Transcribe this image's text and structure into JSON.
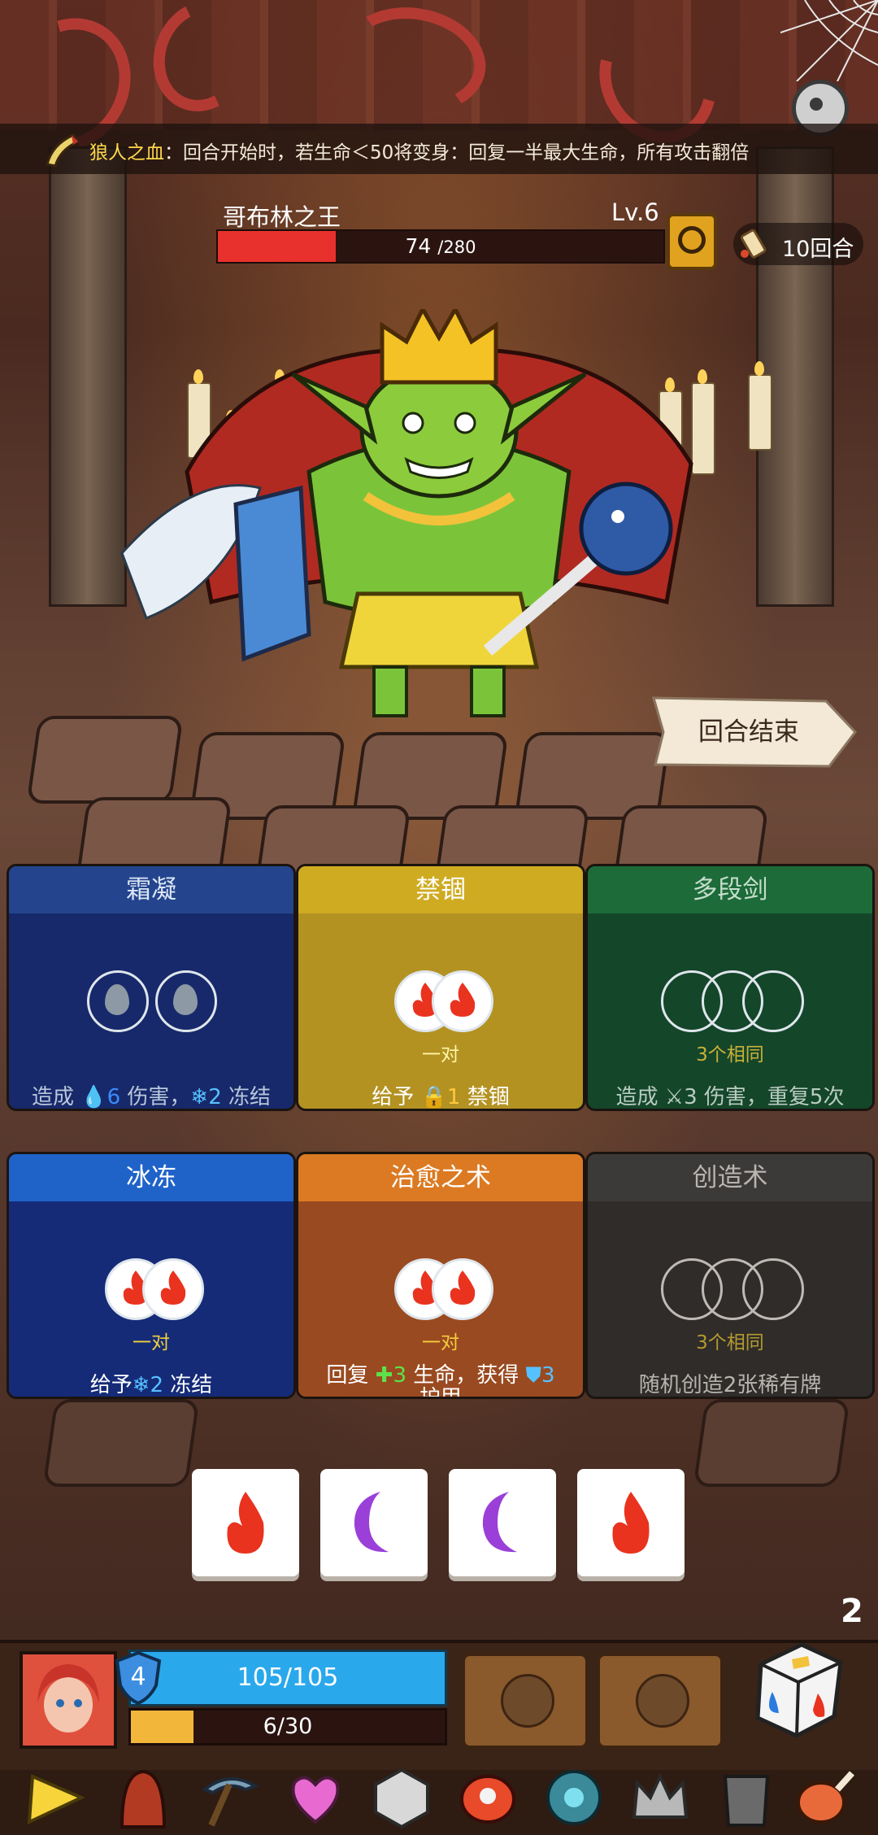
{
  "status": {
    "buff_name": "狼人之血",
    "buff_desc": "：回合开始时，若生命＜50将变身：回复一半最大生命，所有攻击翻倍"
  },
  "boss": {
    "name": "哥布林之王",
    "level": "Lv.6",
    "hp_current": "74",
    "hp_max": "/280",
    "hp_fraction": 0.264
  },
  "round": {
    "label": "10回合"
  },
  "end_turn": {
    "label": "回合结束"
  },
  "cards": [
    {
      "title": "霜凝",
      "requirement": "",
      "desc_prefix": "造成 ",
      "num1": "6",
      "desc_mid": " 伤害，",
      "num2": "2",
      "desc_suffix": " 冻结",
      "color": "#17296a",
      "head": "#24458d"
    },
    {
      "title": "禁锢",
      "requirement": "一对",
      "desc_prefix": "给予 ",
      "num1": "1",
      "desc_suffix": " 禁锢",
      "color": "#b39222",
      "head": "#cfab22"
    },
    {
      "title": "多段剑",
      "requirement": "3个相同",
      "desc_prefix": "造成 ",
      "num1": "3",
      "desc_suffix": " 伤害，重复5次",
      "color": "#14462a",
      "head": "#1c6b39"
    },
    {
      "title": "冰冻",
      "requirement": "一对",
      "desc_prefix": "给予",
      "num1": "2",
      "desc_suffix": " 冻结",
      "color": "#152b78",
      "head": "#1f63c9"
    },
    {
      "title": "治愈之术",
      "requirement": "一对",
      "desc_prefix": "回复 ",
      "num1": "3",
      "desc_mid": " 生命，获得 ",
      "num2": "3",
      "desc_line2": "护甲",
      "color": "#9a4a20",
      "head": "#db7a22"
    },
    {
      "title": "创造术",
      "requirement": "3个相同",
      "desc_prefix": "随机创造2张稀有牌",
      "color": "#2f2c2a",
      "head": "#3c3a38"
    }
  ],
  "dice_tray": [
    "fire",
    "moon",
    "moon",
    "fire"
  ],
  "player": {
    "shield": "4",
    "hp": "105/105",
    "xp": "6/30",
    "xp_fraction": 0.2,
    "rolls_left": "2"
  },
  "icons": {
    "settings": "gear-icon",
    "inspect": "magnifier-icon",
    "round": "scroll-icon"
  }
}
